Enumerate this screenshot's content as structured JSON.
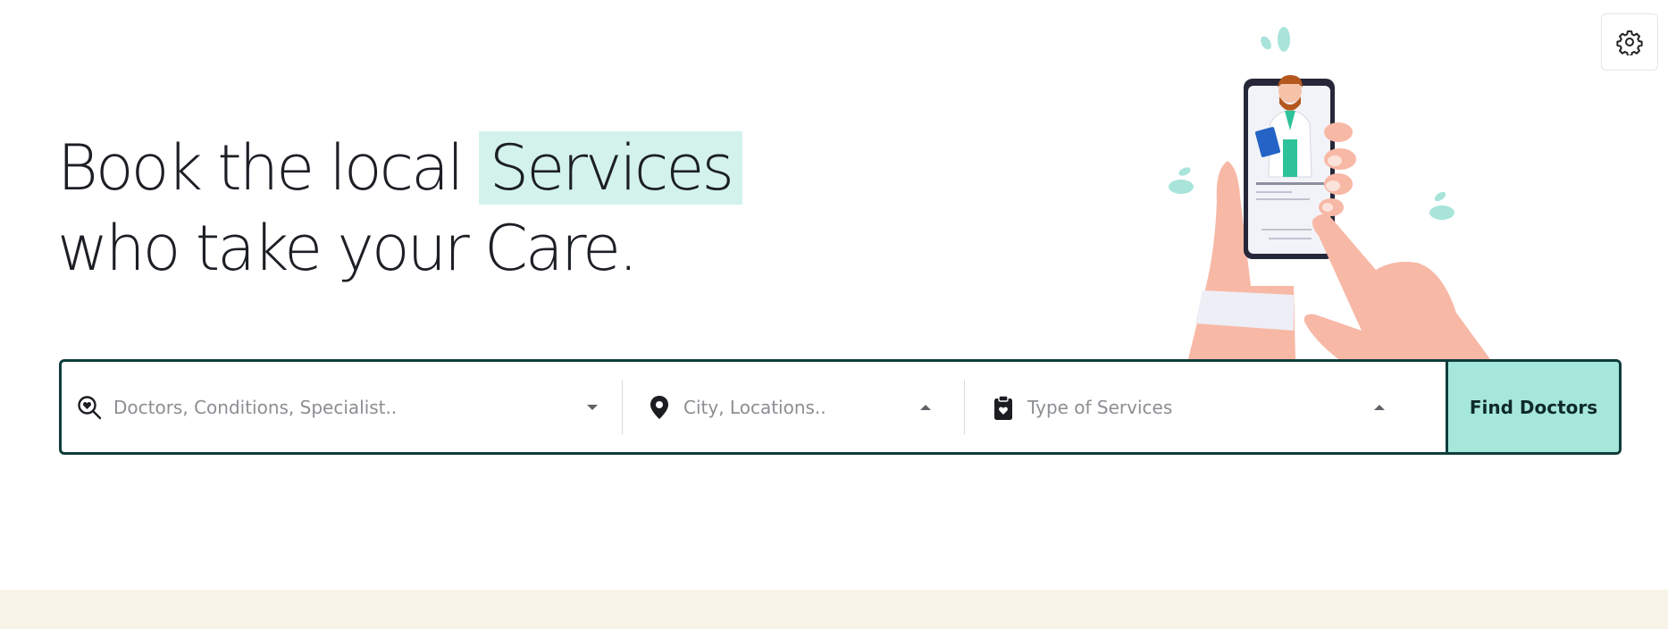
{
  "settings": {
    "icon": "gear-icon"
  },
  "hero": {
    "line1_prefix": "Book the local ",
    "line1_highlight": "Services",
    "line2": "who take your Care."
  },
  "search": {
    "doctors": {
      "placeholder": "Doctors, Conditions, Specialist..",
      "icon": "doctor-search-icon"
    },
    "city": {
      "placeholder": "City, Locations..",
      "icon": "location-pin-icon"
    },
    "service": {
      "placeholder": "Type of Services",
      "icon": "clipboard-heart-icon"
    },
    "button_label": "Find Doctors"
  },
  "colors": {
    "accent": "#a6e7dc",
    "highlight": "#d3f2ec",
    "border": "#0f3d3b",
    "band": "#f8f3e8"
  }
}
